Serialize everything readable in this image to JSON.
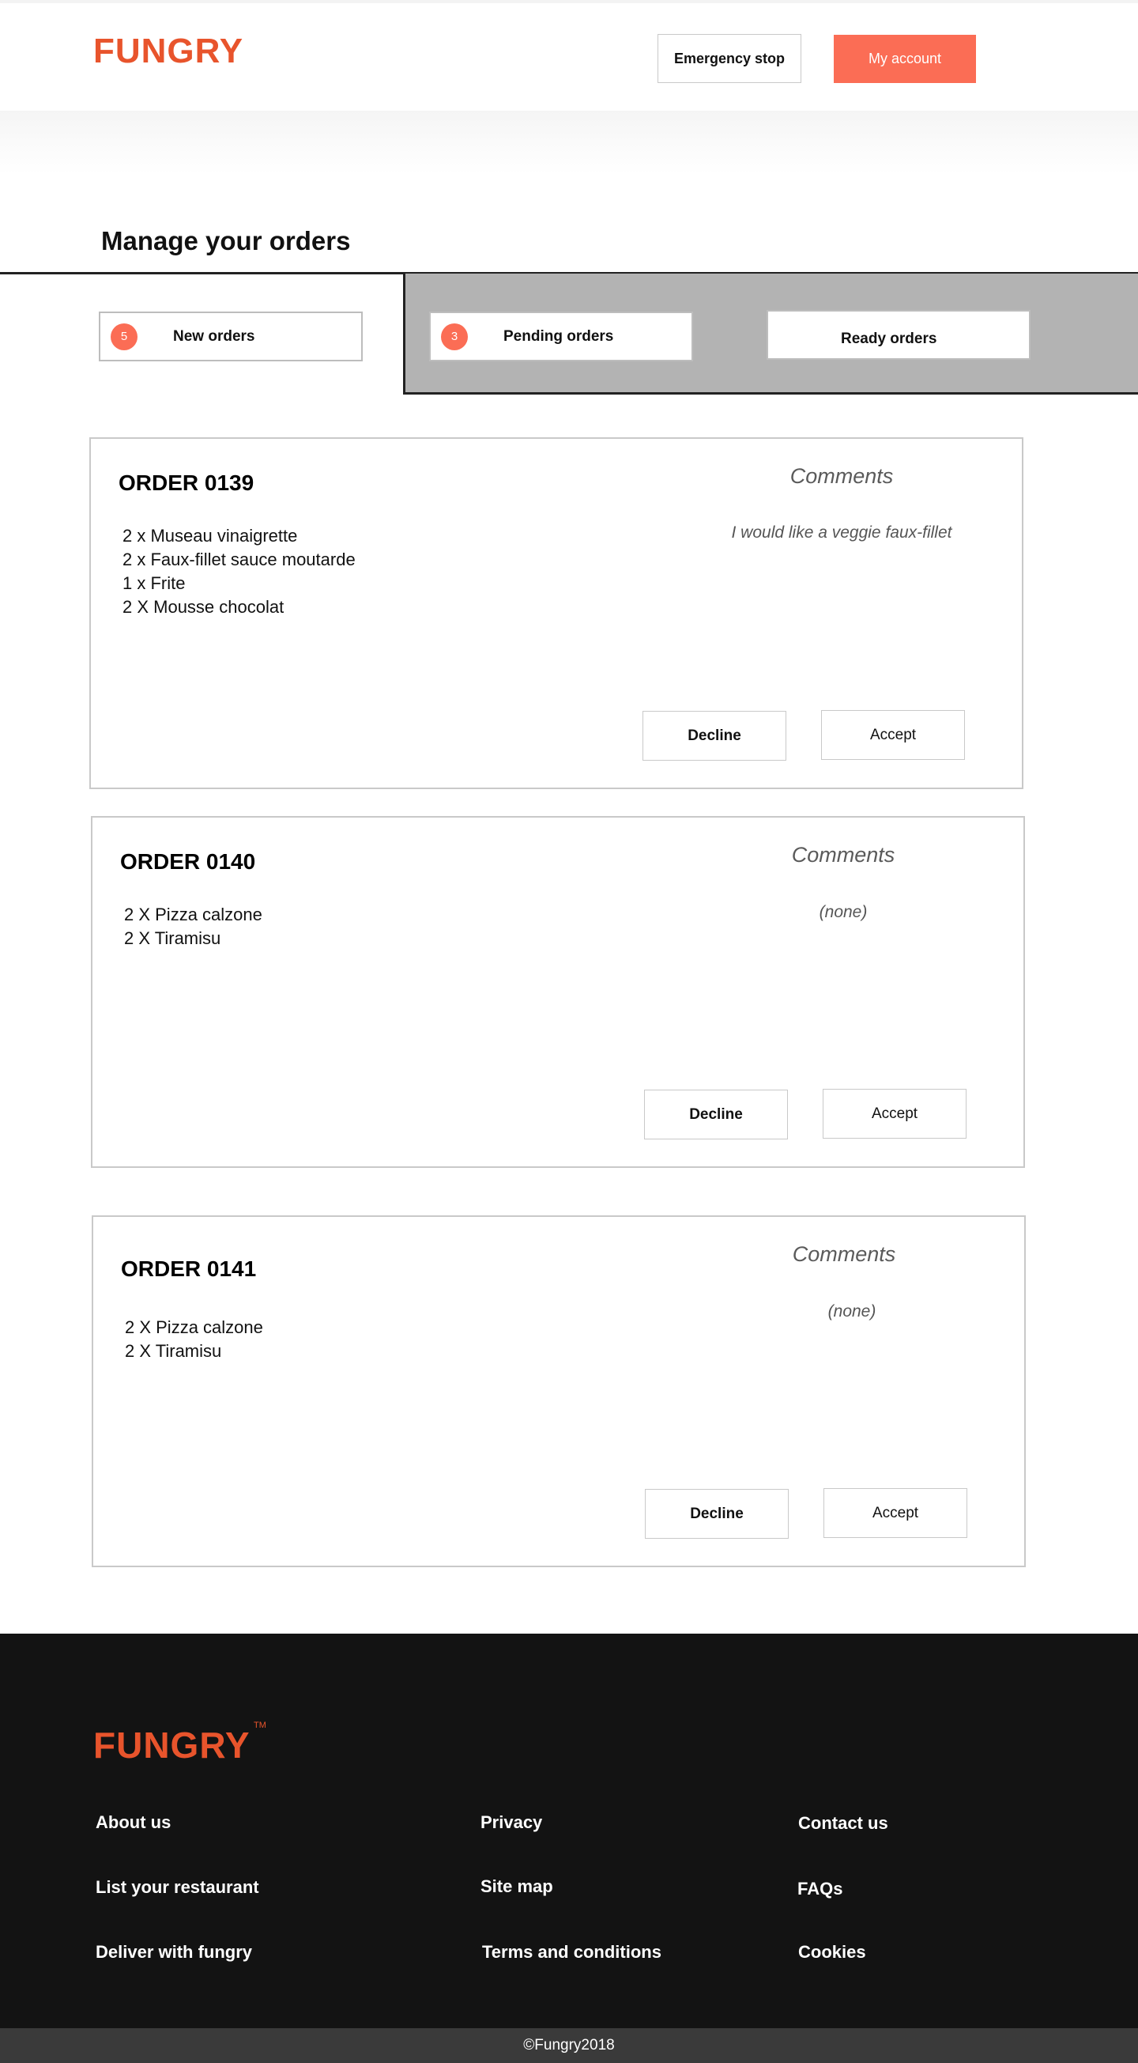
{
  "header": {
    "logo": "FUNGRY",
    "emergency_stop_label": "Emergency stop",
    "my_account_label": "My account"
  },
  "page_title": "Manage your orders",
  "tabs": [
    {
      "label": "New orders",
      "count": "5"
    },
    {
      "label": "Pending orders",
      "count": "3"
    },
    {
      "label": "Ready  orders",
      "count": ""
    }
  ],
  "orders": [
    {
      "title": "ORDER 0139",
      "items": [
        "2 x Museau vinaigrette",
        "2 x Faux-fillet sauce moutarde",
        "1 x Frite",
        "2 X Mousse chocolat"
      ],
      "comments_heading": "Comments",
      "comment": "I would like a veggie faux-fillet",
      "decline_label": "Decline",
      "accept_label": "Accept"
    },
    {
      "title": "ORDER 0140",
      "items": [
        "2 X Pizza calzone",
        "2 X Tiramisu"
      ],
      "comments_heading": "Comments",
      "comment": "(none)",
      "decline_label": "Decline",
      "accept_label": "Accept"
    },
    {
      "title": "ORDER 0141",
      "items": [
        "2 X Pizza calzone",
        "2 X Tiramisu"
      ],
      "comments_heading": "Comments",
      "comment": "(none)",
      "decline_label": "Decline",
      "accept_label": "Accept"
    }
  ],
  "footer": {
    "logo": "FUNGRY",
    "trademark": "TM",
    "links": {
      "about_us": "About us",
      "list_restaurant": "List your restaurant",
      "deliver": "Deliver with fungry",
      "privacy": "Privacy",
      "site_map": "Site map",
      "terms": "Terms and conditions",
      "contact_us": "Contact us",
      "faqs": "FAQs",
      "cookies": "Cookies"
    },
    "copyright": "©Fungry2018"
  },
  "colors": {
    "brand_orange": "#e8542c",
    "accent_coral": "#fb6d55",
    "footer_bg": "#131313",
    "copyright_bg": "#3a3a3a",
    "tab_grey": "#b3b3b3"
  }
}
